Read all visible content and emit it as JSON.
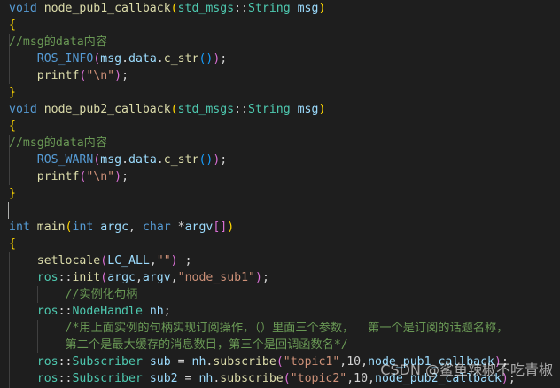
{
  "code_lines": [
    [
      [
        "kw",
        "void"
      ],
      [
        "pn",
        " "
      ],
      [
        "fn",
        "node_pub1_callback"
      ],
      [
        "br1",
        "("
      ],
      [
        "ty",
        "std_msgs"
      ],
      [
        "pn",
        "::"
      ],
      [
        "ty",
        "String"
      ],
      [
        "pn",
        " "
      ],
      [
        "var",
        "msg"
      ],
      [
        "br1",
        ")"
      ]
    ],
    [
      [
        "br1",
        "{"
      ]
    ],
    [
      [
        "cm",
        "//msg的data内容"
      ]
    ],
    [
      [
        "pn",
        "    "
      ],
      [
        "mac",
        "ROS_INFO"
      ],
      [
        "br2",
        "("
      ],
      [
        "var",
        "msg"
      ],
      [
        "pn",
        "."
      ],
      [
        "var",
        "data"
      ],
      [
        "pn",
        "."
      ],
      [
        "fn",
        "c_str"
      ],
      [
        "br3",
        "()"
      ],
      [
        "br2",
        ")"
      ],
      [
        "pn",
        ";"
      ]
    ],
    [
      [
        "pn",
        "    "
      ],
      [
        "fn",
        "printf"
      ],
      [
        "br2",
        "("
      ],
      [
        "str",
        "\"\\n\""
      ],
      [
        "br2",
        ")"
      ],
      [
        "pn",
        ";"
      ]
    ],
    [
      [
        "br1",
        "}"
      ]
    ],
    [
      [
        "kw",
        "void"
      ],
      [
        "pn",
        " "
      ],
      [
        "fn",
        "node_pub2_callback"
      ],
      [
        "br1",
        "("
      ],
      [
        "ty",
        "std_msgs"
      ],
      [
        "pn",
        "::"
      ],
      [
        "ty",
        "String"
      ],
      [
        "pn",
        " "
      ],
      [
        "var",
        "msg"
      ],
      [
        "br1",
        ")"
      ]
    ],
    [
      [
        "br1",
        "{"
      ]
    ],
    [
      [
        "cm",
        "//msg的data内容"
      ]
    ],
    [
      [
        "pn",
        "    "
      ],
      [
        "mac",
        "ROS_WARN"
      ],
      [
        "br2",
        "("
      ],
      [
        "var",
        "msg"
      ],
      [
        "pn",
        "."
      ],
      [
        "var",
        "data"
      ],
      [
        "pn",
        "."
      ],
      [
        "fn",
        "c_str"
      ],
      [
        "br3",
        "()"
      ],
      [
        "br2",
        ")"
      ],
      [
        "pn",
        ";"
      ]
    ],
    [
      [
        "pn",
        "    "
      ],
      [
        "fn",
        "printf"
      ],
      [
        "br2",
        "("
      ],
      [
        "str",
        "\"\\n\""
      ],
      [
        "br2",
        ")"
      ],
      [
        "pn",
        ";"
      ]
    ],
    [
      [
        "br1",
        "}"
      ]
    ],
    [],
    [
      [
        "kw",
        "int"
      ],
      [
        "pn",
        " "
      ],
      [
        "fn",
        "main"
      ],
      [
        "br1",
        "("
      ],
      [
        "kw",
        "int"
      ],
      [
        "pn",
        " "
      ],
      [
        "var",
        "argc"
      ],
      [
        "pn",
        ", "
      ],
      [
        "kw",
        "char"
      ],
      [
        "pn",
        " *"
      ],
      [
        "var",
        "argv"
      ],
      [
        "br2",
        "[]"
      ],
      [
        "br1",
        ")"
      ]
    ],
    [
      [
        "br1",
        "{"
      ]
    ],
    [
      [
        "pn",
        "    "
      ],
      [
        "fn",
        "setlocale"
      ],
      [
        "br2",
        "("
      ],
      [
        "var",
        "LC_ALL"
      ],
      [
        "pn",
        ","
      ],
      [
        "str",
        "\"\""
      ],
      [
        "br2",
        ")"
      ],
      [
        "pn",
        " ;"
      ]
    ],
    [
      [
        "pn",
        "    "
      ],
      [
        "ty",
        "ros"
      ],
      [
        "pn",
        "::"
      ],
      [
        "fn",
        "init"
      ],
      [
        "br2",
        "("
      ],
      [
        "var",
        "argc"
      ],
      [
        "pn",
        ","
      ],
      [
        "var",
        "argv"
      ],
      [
        "pn",
        ","
      ],
      [
        "str",
        "\"node_sub1\""
      ],
      [
        "br2",
        ")"
      ],
      [
        "pn",
        ";"
      ]
    ],
    [
      [
        "pn",
        "        "
      ],
      [
        "cm",
        "//实例化句柄"
      ]
    ],
    [
      [
        "pn",
        "    "
      ],
      [
        "ty",
        "ros"
      ],
      [
        "pn",
        "::"
      ],
      [
        "ty",
        "NodeHandle"
      ],
      [
        "pn",
        " "
      ],
      [
        "var",
        "nh"
      ],
      [
        "pn",
        ";"
      ]
    ],
    [
      [
        "pn",
        "        "
      ],
      [
        "cm",
        "/*用上面实例的句柄实现订阅操作，（）里面三个参数，  第一个是订阅的话题名称，"
      ]
    ],
    [
      [
        "pn",
        "        "
      ],
      [
        "cm",
        "第二个是最大缓存的消息数目，第三个是回调函数名*/"
      ]
    ],
    [
      [
        "pn",
        "    "
      ],
      [
        "ty",
        "ros"
      ],
      [
        "pn",
        "::"
      ],
      [
        "ty",
        "Subscriber"
      ],
      [
        "pn",
        " "
      ],
      [
        "var",
        "sub"
      ],
      [
        "pn",
        " = "
      ],
      [
        "var",
        "nh"
      ],
      [
        "pn",
        "."
      ],
      [
        "fn",
        "subscribe"
      ],
      [
        "br2",
        "("
      ],
      [
        "str",
        "\"topic1\""
      ],
      [
        "pn",
        ",10,"
      ],
      [
        "var",
        "node_pub1_callback"
      ],
      [
        "br2",
        ")"
      ],
      [
        "pn",
        ";"
      ]
    ],
    [
      [
        "pn",
        "    "
      ],
      [
        "ty",
        "ros"
      ],
      [
        "pn",
        "::"
      ],
      [
        "ty",
        "Subscriber"
      ],
      [
        "pn",
        " "
      ],
      [
        "var",
        "sub2"
      ],
      [
        "pn",
        " = "
      ],
      [
        "var",
        "nh"
      ],
      [
        "pn",
        "."
      ],
      [
        "fn",
        "subscribe"
      ],
      [
        "br2",
        "("
      ],
      [
        "str",
        "\"topic2\""
      ],
      [
        "pn",
        ",10,"
      ],
      [
        "var",
        "node_pub2_callback"
      ],
      [
        "br2",
        ")"
      ],
      [
        "pn",
        ";"
      ]
    ]
  ],
  "cursor_line": 12,
  "watermark": "CSDN @鲨鱼辣椒不吃青椒",
  "colors": {
    "background": "#1e1e1e",
    "keyword": "#569cd6",
    "function": "#dcdcaa",
    "type": "#4ec9b0",
    "variable": "#9cdcfe",
    "string": "#ce9178",
    "comment": "#6a9955"
  }
}
